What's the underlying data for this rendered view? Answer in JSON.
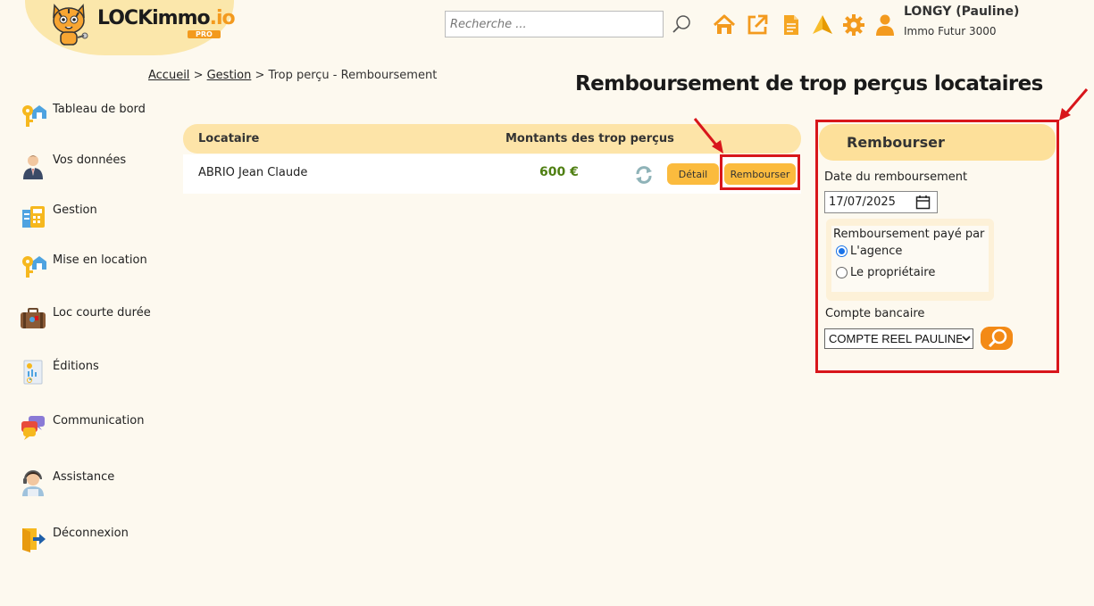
{
  "header": {
    "logo_main": "LOCKimmo",
    "logo_io": ".io",
    "logo_badge": "PRO",
    "search_placeholder": "Recherche ...",
    "icons": [
      "home-icon",
      "external-link-icon",
      "document-icon",
      "plane-icon",
      "gear-icon",
      "user-icon"
    ],
    "user_name": "LONGY (Pauline)",
    "user_agency": "Immo Futur 3000"
  },
  "sidebar": {
    "items": [
      {
        "label": "Tableau de bord",
        "icon": "keys-house-icon"
      },
      {
        "label": "Vos données",
        "icon": "person-icon"
      },
      {
        "label": "Gestion",
        "icon": "calculator-icon"
      },
      {
        "label": "Mise en location",
        "icon": "keys-house-icon"
      },
      {
        "label": "Loc courte durée",
        "icon": "suitcase-icon"
      },
      {
        "label": "Éditions",
        "icon": "report-icon"
      },
      {
        "label": "Communication",
        "icon": "chat-icon"
      },
      {
        "label": "Assistance",
        "icon": "support-agent-icon"
      },
      {
        "label": "Déconnexion",
        "icon": "logout-icon"
      }
    ]
  },
  "breadcrumb": {
    "home": "Accueil",
    "section": "Gestion",
    "sep": ">",
    "current": "Trop perçu - Remboursement"
  },
  "page_heading": "Remboursement de trop perçus locataires",
  "table": {
    "headers": {
      "tenant": "Locataire",
      "amount": "Montants des trop perçus"
    },
    "rows": [
      {
        "tenant": "ABRIO Jean Claude",
        "amount": "600 €",
        "detail_label": "Détail",
        "refund_label": "Rembourser"
      }
    ]
  },
  "panel": {
    "title": "Rembourser",
    "date_label": "Date du remboursement",
    "date_value": "17/07/2025",
    "paid_by_legend": "Remboursement payé par",
    "options": [
      {
        "label": "L'agence",
        "selected": true
      },
      {
        "label": "Le propriétaire",
        "selected": false
      }
    ],
    "bank_label": "Compte bancaire",
    "bank_value": "COMPTE REEL PAULINE"
  },
  "colors": {
    "accent": "#f39a1e",
    "button": "#fbbb3e",
    "highlight": "#d8161b",
    "amount": "#4f7f12",
    "header_band": "#fde4a8"
  }
}
